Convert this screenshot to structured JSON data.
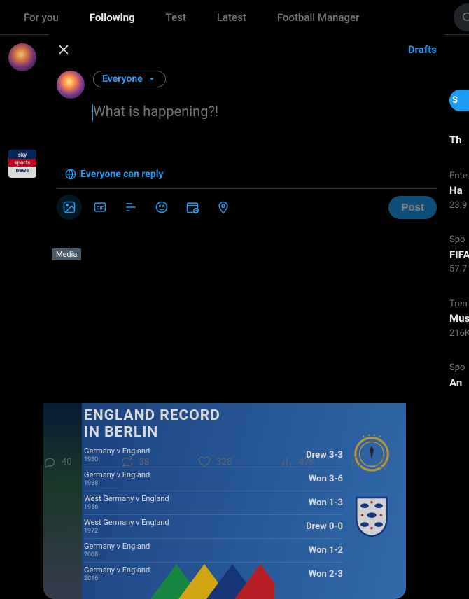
{
  "tabs": [
    "For you",
    "Following",
    "Test",
    "Latest",
    "Football Manager"
  ],
  "compose": {
    "drafts": "Drafts",
    "audience": "Everyone",
    "placeholder": "What is happening?!",
    "reply_setting": "Everyone can reply",
    "post": "Post",
    "media_tooltip": "Media"
  },
  "card": {
    "title_l1": "ENGLAND RECORD",
    "title_l2": "IN BERLIN",
    "rows": [
      {
        "match": "Germany v England",
        "year": "1930",
        "result": "Drew 3-3"
      },
      {
        "match": "Germany v England",
        "year": "1938",
        "result": "Won 3-6"
      },
      {
        "match": "West Germany v England",
        "year": "1956",
        "result": "Won 1-3"
      },
      {
        "match": "West Germany v England",
        "year": "1972",
        "result": "Drew 0-0"
      },
      {
        "match": "Germany v England",
        "year": "2008",
        "result": "Won 1-2"
      },
      {
        "match": "Germany v England",
        "year": "2016",
        "result": "Won 2-3"
      }
    ]
  },
  "metrics": {
    "replies": "40",
    "reposts": "38",
    "likes": "328",
    "views": "47K"
  },
  "trends": [
    {
      "cat": "Ente",
      "title": "Ha",
      "sub": "23.9"
    },
    {
      "cat": "Spo",
      "title": "FIFA",
      "sub": "57.7"
    },
    {
      "cat": "Tren",
      "title": "Mus",
      "sub": "216K"
    },
    {
      "cat": "Spo",
      "title": "An",
      "sub": ""
    }
  ],
  "subscribe": "S",
  "whats": "Th"
}
